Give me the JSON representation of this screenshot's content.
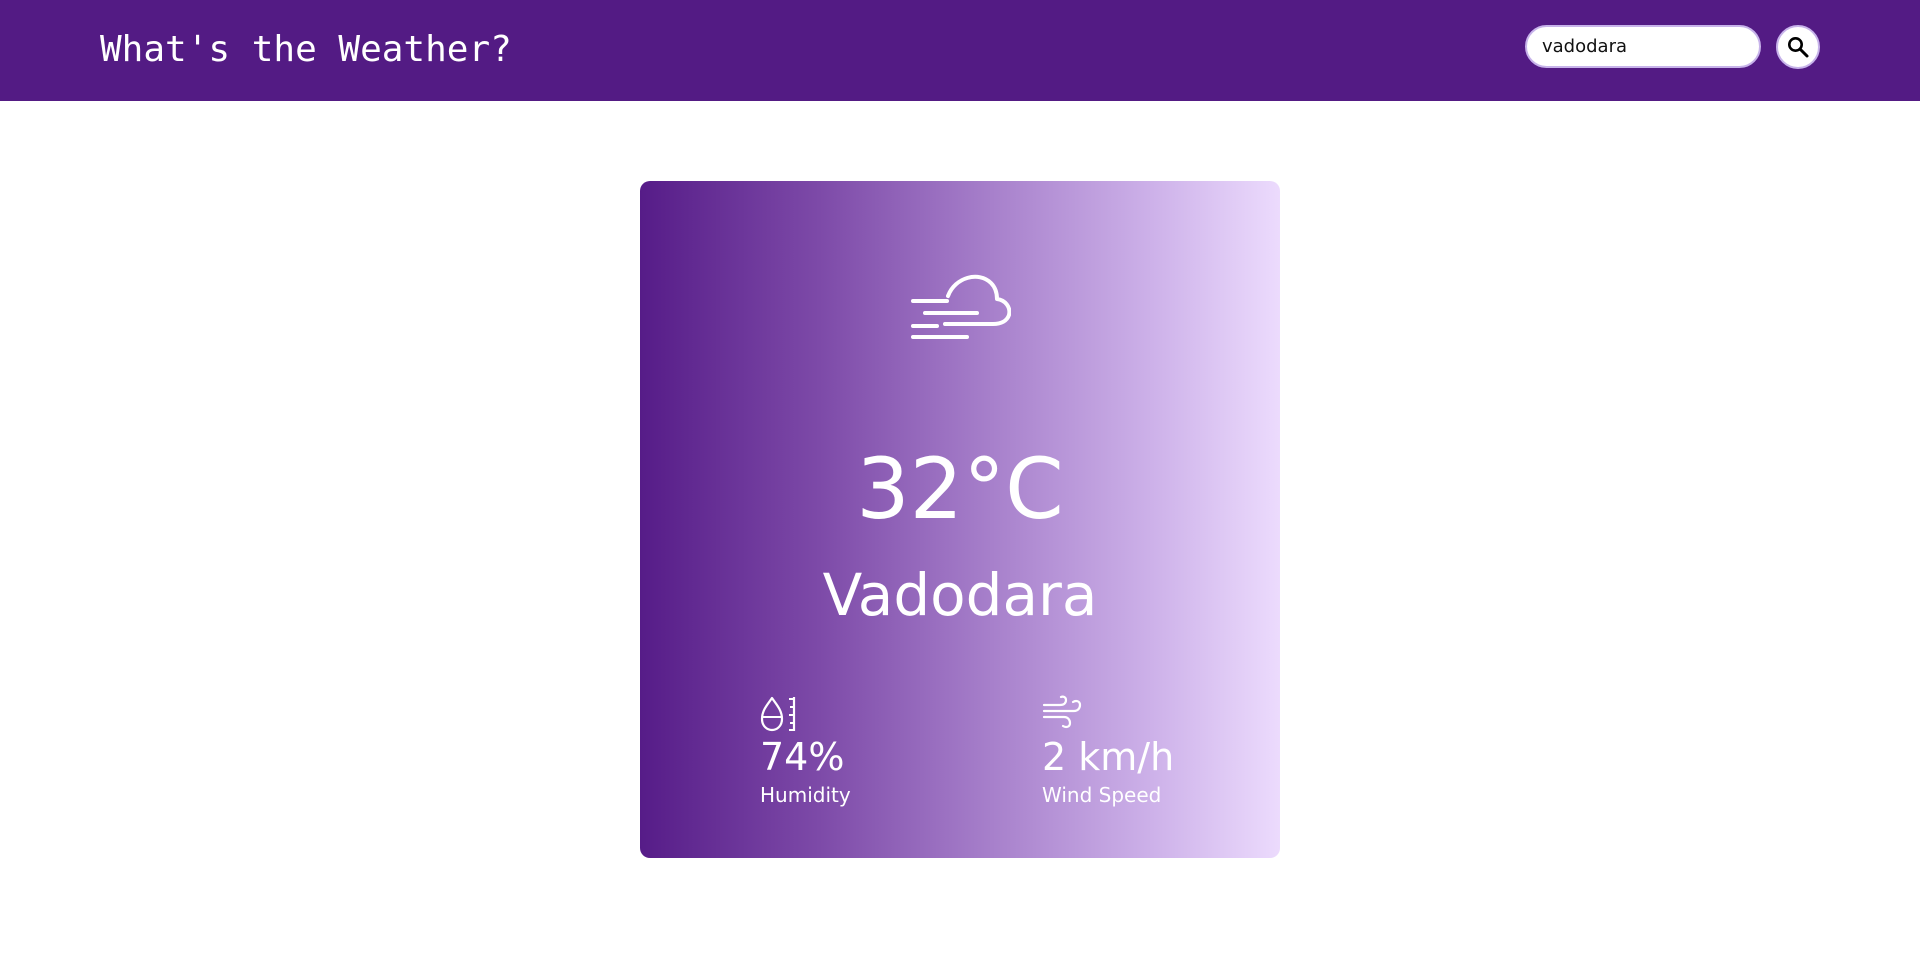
{
  "header": {
    "title": "What's the Weather?",
    "background_color": "#531b84"
  },
  "search": {
    "value": "vadodara",
    "button_icon": "search-icon"
  },
  "card": {
    "gradient_colors": [
      "#561c88",
      "#ecdbfd"
    ],
    "weather_icon": "mist-icon",
    "temperature": "32°C",
    "city": "Vadodara",
    "humidity": {
      "icon": "humidity-icon",
      "value": "74%",
      "label": "Humidity"
    },
    "wind": {
      "icon": "wind-icon",
      "value": "2 km/h",
      "label": "Wind Speed"
    }
  }
}
